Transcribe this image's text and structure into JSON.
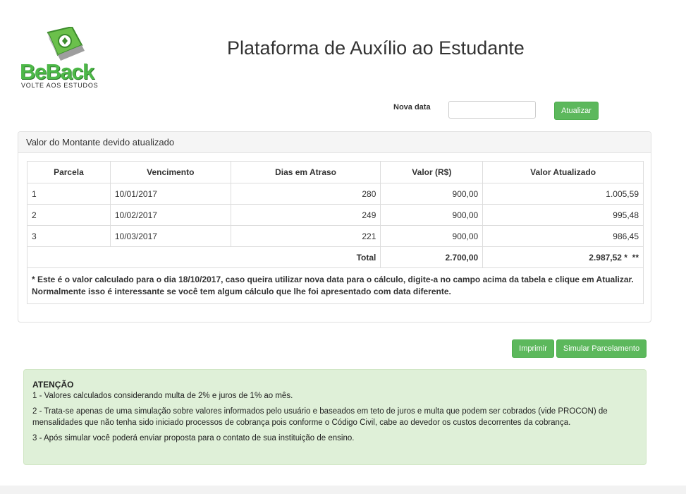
{
  "brand": {
    "name": "BeBack",
    "tagline": "VOLTE AOS ESTUDOS",
    "accent_color": "#4db848"
  },
  "header": {
    "title": "Plataforma de Auxílio ao Estudante"
  },
  "date_form": {
    "label": "Nova data",
    "value": "",
    "placeholder": "",
    "submit_label": "Atualizar"
  },
  "panel": {
    "heading": "Valor do Montante devido atualizado",
    "columns": [
      "Parcela",
      "Vencimento",
      "Dias em Atraso",
      "Valor (R$)",
      "Valor Atualizado"
    ],
    "rows": [
      {
        "parcela": "1",
        "vencimento": "10/01/2017",
        "dias": "280",
        "valor": "900,00",
        "atualizado": "1.005,59"
      },
      {
        "parcela": "2",
        "vencimento": "10/02/2017",
        "dias": "249",
        "valor": "900,00",
        "atualizado": "995,48"
      },
      {
        "parcela": "3",
        "vencimento": "10/03/2017",
        "dias": "221",
        "valor": "900,00",
        "atualizado": "986,45"
      }
    ],
    "total": {
      "label": "Total",
      "valor": "2.700,00",
      "atualizado": "2.987,52 *  **"
    },
    "footnote": "* Este é o valor calculado para o dia 18/10/2017, caso queira utilizar nova data para o cálculo, digite-a no campo acima da tabela e clique em Atualizar. Normalmente isso é interessante se você tem algum cálculo que lhe foi apresentado com data diferente."
  },
  "actions": {
    "print_label": "Imprimir",
    "simulate_label": "Simular Parcelamento",
    "button_color": "#5cb85c"
  },
  "notice": {
    "title": "ATENÇÃO",
    "items": [
      "1 - Valores calculados considerando multa de 2% e juros de 1% ao mês.",
      "2 - Trata-se apenas de uma simulação sobre valores informados pelo usuário e baseados em teto de juros e multa que podem ser cobrados (vide PROCON) de mensalidades que não tenha sido iniciado processos de cobrança pois conforme o Código Civil, cabe ao devedor os custos decorrentes da cobrança.",
      "3 - Após simular você poderá enviar proposta para o contato de sua instituição de ensino."
    ],
    "background_color": "#dff0d8"
  }
}
